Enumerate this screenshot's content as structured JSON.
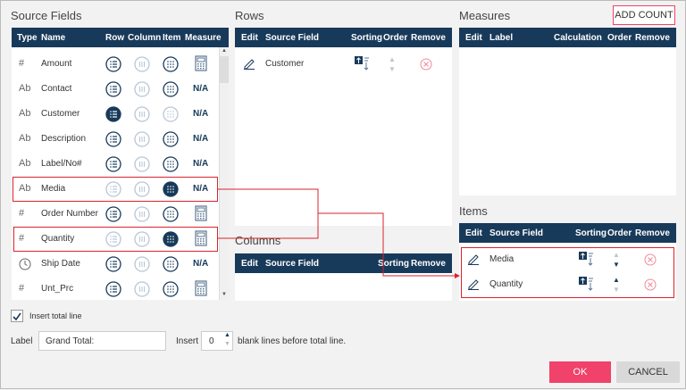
{
  "source_fields": {
    "title": "Source Fields",
    "headers": [
      "Type",
      "Name",
      "Row",
      "Column",
      "Item",
      "Measure"
    ],
    "rows": [
      {
        "type": "#",
        "name": "Amount",
        "row": "normal",
        "column": "disabled",
        "item": "normal",
        "measure": "calculator-icon"
      },
      {
        "type": "Ab",
        "name": "Contact",
        "row": "normal",
        "column": "disabled",
        "item": "normal",
        "measure": "N/A"
      },
      {
        "type": "Ab",
        "name": "Customer",
        "row": "selected",
        "column": "disabled",
        "item": "disabled",
        "measure": "N/A"
      },
      {
        "type": "Ab",
        "name": "Description",
        "row": "normal",
        "column": "disabled",
        "item": "normal",
        "measure": "N/A"
      },
      {
        "type": "Ab",
        "name": "Label/No#",
        "row": "normal",
        "column": "disabled",
        "item": "normal",
        "measure": "N/A"
      },
      {
        "type": "Ab",
        "name": "Media",
        "row": "disabled",
        "column": "disabled",
        "item": "selected",
        "measure": "N/A",
        "highlighted": true
      },
      {
        "type": "#",
        "name": "Order Number",
        "row": "normal",
        "column": "disabled",
        "item": "normal",
        "measure": "calculator-icon"
      },
      {
        "type": "#",
        "name": "Quantity",
        "row": "disabled",
        "column": "disabled",
        "item": "selected",
        "measure": "calculator-icon",
        "highlighted": true
      },
      {
        "type": "clock",
        "name": "Ship Date",
        "row": "normal",
        "column": "disabled",
        "item": "normal",
        "measure": "N/A"
      },
      {
        "type": "#",
        "name": "Unt_Prc",
        "row": "normal",
        "column": "disabled",
        "item": "normal",
        "measure": "calculator-icon"
      }
    ]
  },
  "rows_panel": {
    "title": "Rows",
    "headers": [
      "Edit",
      "Source Field",
      "Sorting",
      "Order",
      "Remove"
    ],
    "items": [
      {
        "field": "Customer"
      }
    ]
  },
  "columns_panel": {
    "title": "Columns",
    "headers": [
      "Edit",
      "Source Field",
      "Sorting",
      "Remove"
    ]
  },
  "measures_panel": {
    "title": "Measures",
    "add_count": "ADD COUNT",
    "headers": [
      "Edit",
      "Label",
      "Calculation",
      "Order",
      "Remove"
    ]
  },
  "items_panel": {
    "title": "Items",
    "headers": [
      "Edit",
      "Source Field",
      "Sorting",
      "Order",
      "Remove"
    ],
    "items": [
      {
        "field": "Media"
      },
      {
        "field": "Quantity"
      }
    ]
  },
  "options": {
    "insert_total_line": "Insert total line",
    "insert_total_checked": true,
    "label_label": "Label",
    "label_value": "Grand Total:",
    "insert_label": "Insert",
    "blank_lines": "0",
    "blank_lines_suffix": "blank lines before total line."
  },
  "footer": {
    "ok": "OK",
    "cancel": "CANCEL"
  },
  "colors": {
    "header": "#183a5a",
    "accent": "#f0426a",
    "highlight": "#d9232e"
  }
}
